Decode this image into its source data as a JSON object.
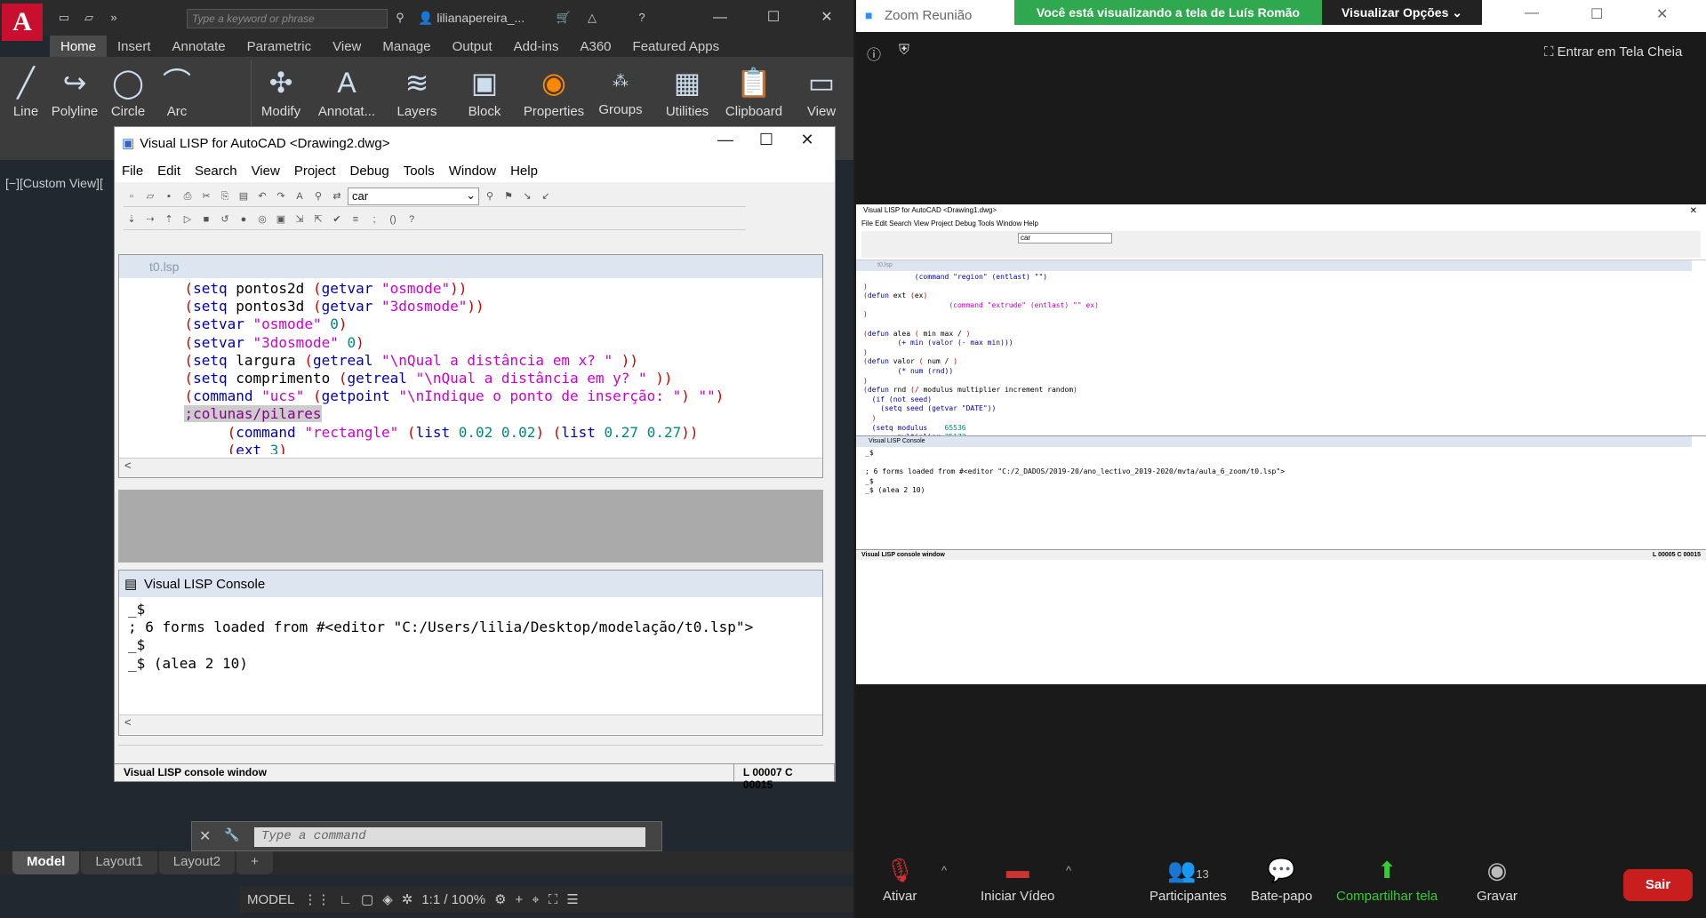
{
  "acad": {
    "search_placeholder": "Type a keyword or phrase",
    "user": "lilianapereira_...",
    "tabs": [
      "Home",
      "Insert",
      "Annotate",
      "Parametric",
      "View",
      "Manage",
      "Output",
      "Add-ins",
      "A360",
      "Featured Apps"
    ],
    "ribbon": {
      "line": "Line",
      "polyline": "Polyline",
      "circle": "Circle",
      "arc": "Arc",
      "modify": "Modify",
      "annotate": "Annotat...",
      "layers": "Layers",
      "block": "Block",
      "properties": "Properties",
      "groups": "Groups",
      "utilities": "Utilities",
      "clipboard": "Clipboard",
      "view": "View"
    },
    "view_label": "[−][Custom View][",
    "cmd_placeholder": "Type a command",
    "layout_tabs": [
      "Model",
      "Layout1",
      "Layout2"
    ],
    "status": {
      "model": "MODEL",
      "scale": "1:1 / 100%"
    }
  },
  "vlisp": {
    "title": "Visual LISP for AutoCAD <Drawing2.dwg>",
    "menu": [
      "File",
      "Edit",
      "Search",
      "View",
      "Project",
      "Debug",
      "Tools",
      "Window",
      "Help"
    ],
    "search_value": "car",
    "editor_title": "t0.lsp",
    "console_title": "Visual LISP Console",
    "console_lines": [
      "_$",
      "; 6 forms loaded from #<editor \"C:/Users/lilia/Desktop/modelação/t0.lsp\">",
      "_$",
      "_$ (alea 2 10)"
    ],
    "status_left": "Visual LISP console window",
    "status_right": "L 00007  C 00015"
  },
  "zoom": {
    "title": "Zoom Reunião",
    "banner": "Você está visualizando a tela de Luís Romão",
    "options": "Visualizar Opções",
    "fullscreen": "Entrar em Tela Cheia",
    "shared_title": "Visual LISP for AutoCAD <Drawing1.dwg>",
    "shared_menu": "File  Edit  Search  View  Project  Debug  Tools  Window  Help",
    "shared_editor_title": "t0.lsp",
    "shared_console_title": "Visual LISP Console",
    "shared_console": "_$\n\n; 6 forms loaded from #<editor \"C:/2_DADOS/2019-20/ano_lectivo_2019-2020/mvta/aula_6_zoom/t0.lsp\">\n_$\n_$ (alea 2 10)",
    "shared_status_left": "Visual LISP console window",
    "shared_status_right": "L 00005  C 00015",
    "buttons": {
      "mute": "Ativar",
      "video": "Iniciar Vídeo",
      "participants": "Participantes",
      "participants_count": "13",
      "chat": "Bate-papo",
      "share": "Compartilhar tela",
      "record": "Gravar",
      "leave": "Sair"
    }
  }
}
